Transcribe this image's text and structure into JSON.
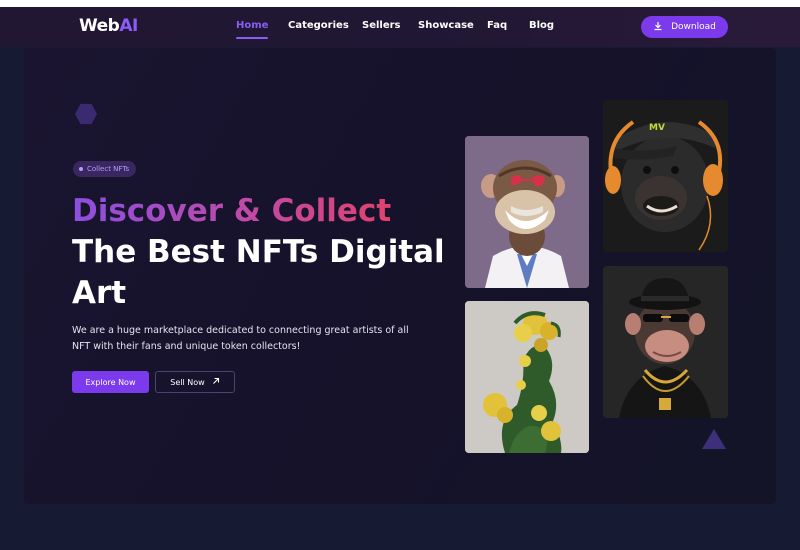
{
  "brand": {
    "logo_main": "Web",
    "logo_accent": "AI"
  },
  "nav": {
    "items": [
      "Home",
      "Categories",
      "Sellers",
      "Showcase",
      "Faq",
      "Blog"
    ],
    "active": "Home"
  },
  "header": {
    "download_label": "Download",
    "download_icon": "download-icon"
  },
  "hero": {
    "badge": "Collect NFTs",
    "title_gradient": "Discover & Collect",
    "title_line2": "The Best NFTs Digital",
    "title_line3": "Art",
    "description": "We are a huge marketplace dedicated to connecting great artists of all NFT with their fans and unique token collectors!",
    "primary_button": "Explore Now",
    "secondary_button": "Sell Now",
    "secondary_icon": "arrow-up-right-icon"
  },
  "gallery": [
    {
      "name": "ape-heart-glasses-lab-coat"
    },
    {
      "name": "flower-bust-sculpture"
    },
    {
      "name": "ape-cap-headphones"
    },
    {
      "name": "ape-bowler-hat-gold-chain"
    }
  ],
  "colors": {
    "accent": "#7c3aed",
    "gradient_start": "#8b4fe0",
    "gradient_end": "#e0436e",
    "background": "#161a33"
  }
}
